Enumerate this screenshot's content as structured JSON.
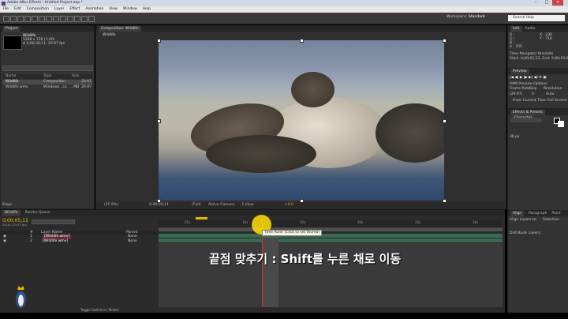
{
  "window": {
    "title": "Adobe After Effects - Untitled Project.aep *"
  },
  "menu": [
    "File",
    "Edit",
    "Composition",
    "Layer",
    "Effect",
    "Animation",
    "View",
    "Window",
    "Help"
  ],
  "toolbar": {
    "workspace_label": "Workspace:",
    "workspace_value": "Standard",
    "search_help_placeholder": "Search Help"
  },
  "project": {
    "tab": "Project",
    "selected_name": "Wildlife",
    "selected_info": [
      "1280 x 720 (1.00)",
      "Δ 0;00;30;11, 29.97 fps"
    ],
    "search_placeholder": "",
    "columns": [
      "Name",
      "Type",
      "Size"
    ],
    "items": [
      {
        "name": "Wildlife",
        "type": "Composition",
        "extra": "29.97"
      },
      {
        "name": "Wildlife.wmv",
        "type": "Windows...ca",
        "size": "...MB",
        "extra": "29.97"
      }
    ],
    "bpc": "8 bpc"
  },
  "composition": {
    "tab_label": "Composition: Wildlife",
    "breadcrumb": "Wildlife",
    "footer": [
      "(25.9%)",
      "0;00;05;11",
      "(Full)",
      "Active Camera",
      "1 View",
      "+0.0"
    ]
  },
  "info": {
    "tabs": [
      "Info",
      "Audio"
    ],
    "lines": [
      "R :",
      "G :",
      "B :",
      "A : 255",
      "X : 236",
      "Y : 716"
    ],
    "extra": [
      "Time Navigator Brackets",
      "Start: 0;00;01;12, End: 0;00;05;06"
    ]
  },
  "preview": {
    "tab": "Preview",
    "options": "RAM Preview Options",
    "frame_rate_label": "Frame Rate",
    "skip_label": "Skip",
    "resolution_label": "Resolution",
    "frame_rate": "(29.97)",
    "skip": "0",
    "resolution": "Auto",
    "from_current": "From Current Time",
    "full_screen": "Full Screen"
  },
  "effects": {
    "tabs": [
      "Effects & Presets",
      "Character"
    ],
    "font_size": "36 px"
  },
  "align": {
    "tabs": [
      "Align",
      "Paragraph",
      "Paint"
    ],
    "align_to": "Align Layers to:",
    "align_to_value": "Selection",
    "distribute": "Distribute Layers:"
  },
  "timeline": {
    "tab": "Wildlife",
    "render_tab": "Render Queue",
    "timecode": "0;00;05;11",
    "timecode_sub": "00161 (29.97 fps)",
    "layer_header": [
      "#",
      "Layer Name",
      "Parent"
    ],
    "layers": [
      {
        "num": "1",
        "name": "[Wildlife.wmv]",
        "parent": "None"
      },
      {
        "num": "2",
        "name": "[Wildlife.wmv]",
        "parent": "None"
      }
    ],
    "ruler": [
      "05s",
      "10s",
      "15s",
      "20s",
      "25s",
      "30s"
    ],
    "tooltip": "Time Ruler (Click to set thumb)",
    "toggle_label": "Toggle Switches / Modes"
  },
  "caption": "끝점 맞추기 : Shift를 누른 채로 이동",
  "colors": {
    "accent": "#e8b800",
    "playhead": "#d83030",
    "track_green": "#3b6a52"
  }
}
